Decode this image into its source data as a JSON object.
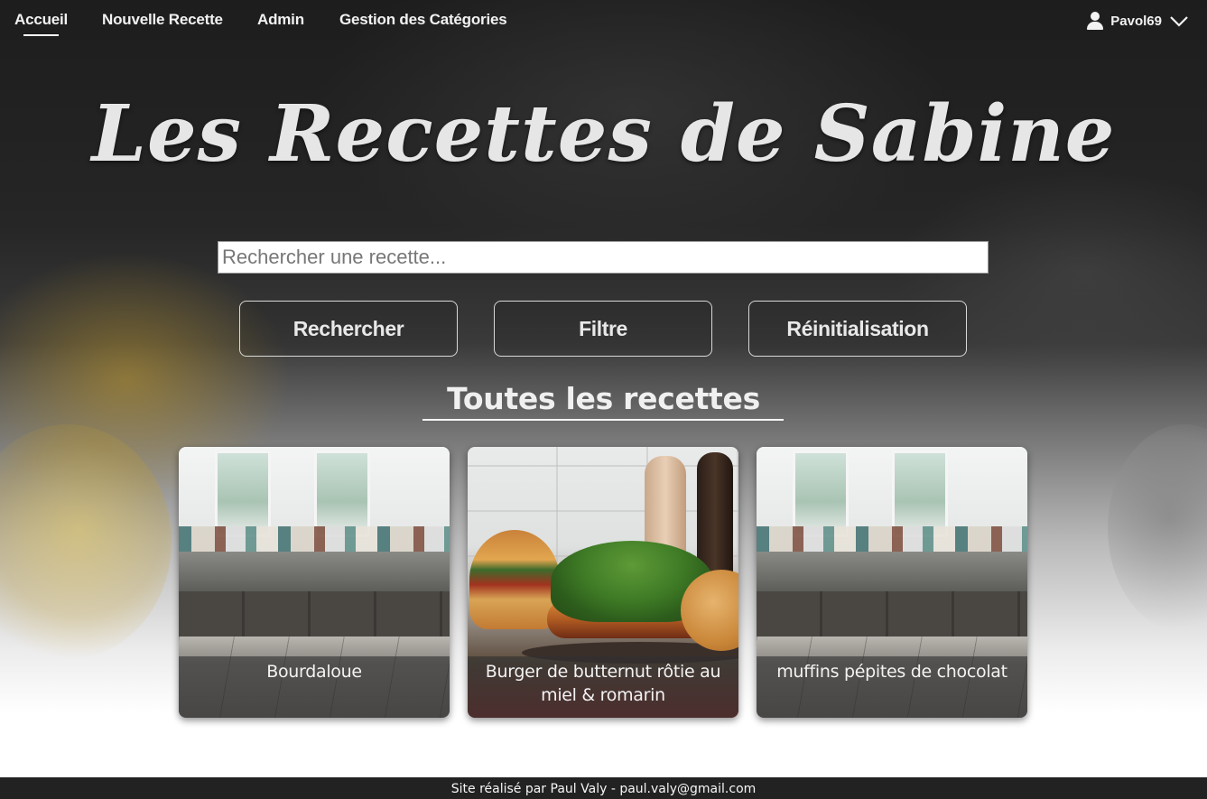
{
  "nav": {
    "links": [
      {
        "label": "Accueil",
        "active": true
      },
      {
        "label": "Nouvelle Recette",
        "active": false
      },
      {
        "label": "Admin",
        "active": false
      },
      {
        "label": "Gestion des Catégories",
        "active": false
      }
    ],
    "user": {
      "name": "Pavol69",
      "icon": "user-icon",
      "menu_icon": "chevron-down-icon"
    }
  },
  "header": {
    "title": "Les Recettes de Sabine"
  },
  "search": {
    "placeholder": "Rechercher une recette...",
    "value": ""
  },
  "actions": {
    "search_label": "Rechercher",
    "filter_label": "Filtre",
    "reset_label": "Réinitialisation"
  },
  "recipes": {
    "heading": "Toutes les recettes",
    "items": [
      {
        "title": "Bourdaloue",
        "image": "kitchen-photo"
      },
      {
        "title": "Burger de butternut rôtie au miel & romarin",
        "image": "burger-photo"
      },
      {
        "title": "muffins pépites de chocolat",
        "image": "kitchen-photo"
      }
    ]
  },
  "footer": {
    "text": "Site réalisé par Paul Valy - paul.valy@gmail.com"
  },
  "colors": {
    "background_dark": "#1d1d1d",
    "footer_bg": "#222222",
    "text_light": "#f2f2f2"
  }
}
